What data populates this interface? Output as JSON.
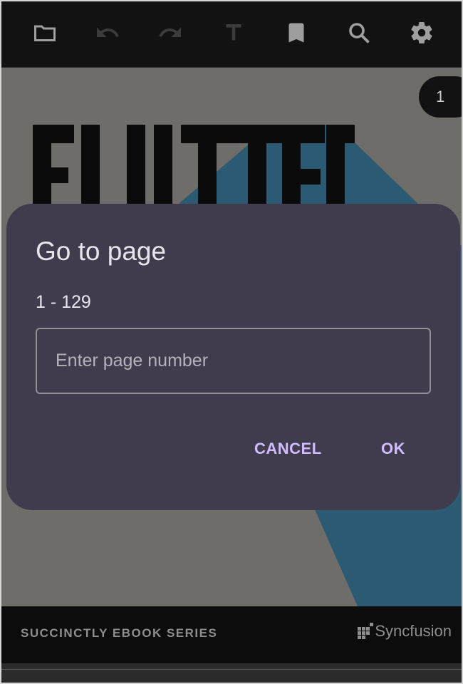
{
  "toolbar": {
    "icons": [
      "folder-icon",
      "undo-icon",
      "redo-icon",
      "text-icon",
      "bookmark-icon",
      "search-icon",
      "settings-icon"
    ],
    "active_color": "#9e9e9e",
    "disabled_color": "#3c3c3c"
  },
  "viewer": {
    "page_number": "1",
    "cover_title_visible": "FLUTTER",
    "series_label": "SUCCINCTLY EBOOK SERIES",
    "brand": "Syncfusion"
  },
  "dialog": {
    "title": "Go to page",
    "range": "1 - 129",
    "input_placeholder": "Enter page number",
    "input_value": "",
    "cancel_label": "CANCEL",
    "ok_label": "OK",
    "accent_color": "#d0bcff",
    "background_color": "#413c4d"
  }
}
